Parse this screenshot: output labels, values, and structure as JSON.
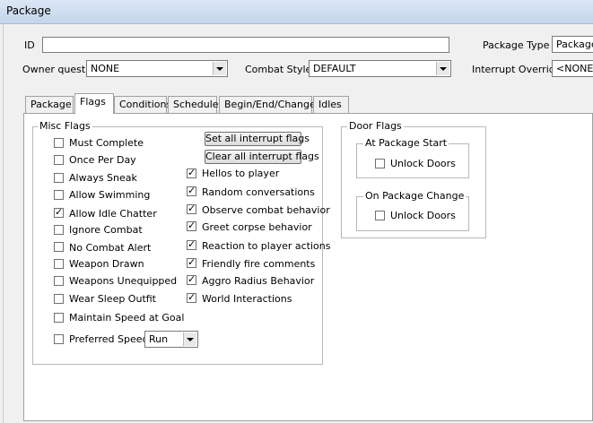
{
  "window": {
    "title": "Package"
  },
  "fields": {
    "id_label": "ID",
    "id_value": "",
    "package_type_label": "Package Type",
    "package_type_value": "Package",
    "owner_quest_label": "Owner quest",
    "owner_quest_value": "NONE",
    "combat_style_label": "Combat Style",
    "combat_style_value": "DEFAULT",
    "interrupt_override_label": "Interrupt Override",
    "interrupt_override_value": "<NONE>"
  },
  "tabs": [
    {
      "label": "Package",
      "active": false
    },
    {
      "label": "Flags",
      "active": true
    },
    {
      "label": "Conditions",
      "active": false
    },
    {
      "label": "Schedule",
      "active": false
    },
    {
      "label": "Begin/End/Change",
      "active": false
    },
    {
      "label": "Idles",
      "active": false
    }
  ],
  "misc_flags": {
    "title": "Misc Flags",
    "items": [
      {
        "label": "Must Complete",
        "checked": false
      },
      {
        "label": "Once Per Day",
        "checked": false
      },
      {
        "label": "Always Sneak",
        "checked": false
      },
      {
        "label": "Allow Swimming",
        "checked": false
      },
      {
        "label": "Allow Idle Chatter",
        "checked": true
      },
      {
        "label": "Ignore Combat",
        "checked": false
      },
      {
        "label": "No Combat Alert",
        "checked": false
      },
      {
        "label": "Weapon Drawn",
        "checked": false
      },
      {
        "label": "Weapons Unequipped",
        "checked": false
      },
      {
        "label": "Wear Sleep Outfit",
        "checked": false
      },
      {
        "label": "Maintain Speed at Goal",
        "checked": false
      },
      {
        "label": "Preferred Speed",
        "checked": false
      }
    ],
    "preferred_speed_value": "Run",
    "set_all_button": "Set all interrupt flags",
    "clear_all_button": "Clear all interrupt flags",
    "interrupt_items": [
      {
        "label": "Hellos to player",
        "checked": true
      },
      {
        "label": "Random conversations",
        "checked": true
      },
      {
        "label": "Observe combat behavior",
        "checked": true
      },
      {
        "label": "Greet corpse behavior",
        "checked": true
      },
      {
        "label": "Reaction to player actions",
        "checked": true
      },
      {
        "label": "Friendly fire comments",
        "checked": true
      },
      {
        "label": "Aggro Radius Behavior",
        "checked": true
      },
      {
        "label": "World Interactions",
        "checked": true
      }
    ]
  },
  "door_flags": {
    "title": "Door Flags",
    "at_start_title": "At Package Start",
    "at_start_label": "Unlock Doors",
    "at_start_checked": false,
    "on_change_title": "On Package Change",
    "on_change_label": "Unlock Doors",
    "on_change_checked": false
  }
}
